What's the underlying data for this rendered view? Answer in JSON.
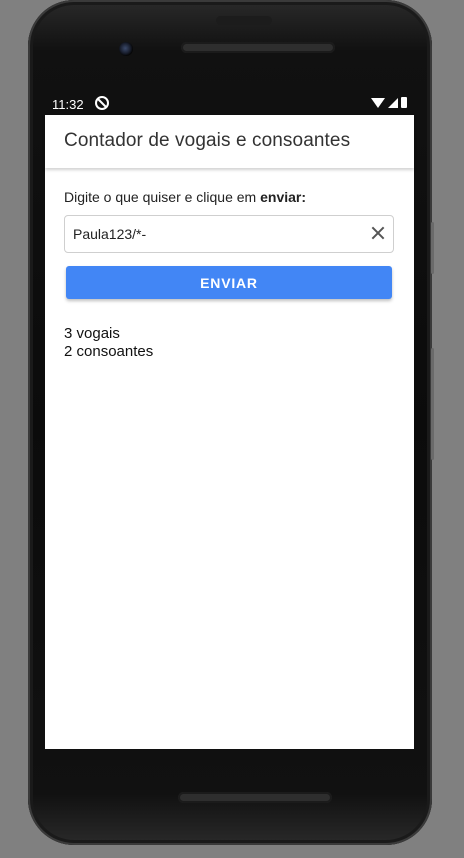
{
  "status_bar": {
    "time": "11:32",
    "icons": [
      "do-not-disturb-icon",
      "wifi-icon",
      "signal-icon",
      "battery-icon"
    ]
  },
  "app_bar": {
    "title": "Contador de vogais e consoantes"
  },
  "form": {
    "prompt_text": "Digite o que quiser e clique em ",
    "prompt_bold": "enviar:",
    "input_value": "Paula123/*-",
    "clear_icon": "close-icon",
    "submit_label": "ENVIAR"
  },
  "results": {
    "vowels": "3 vogais",
    "consonants": "2 consoantes"
  },
  "colors": {
    "accent": "#4286f5",
    "background": "#808080",
    "surface": "#ffffff"
  }
}
